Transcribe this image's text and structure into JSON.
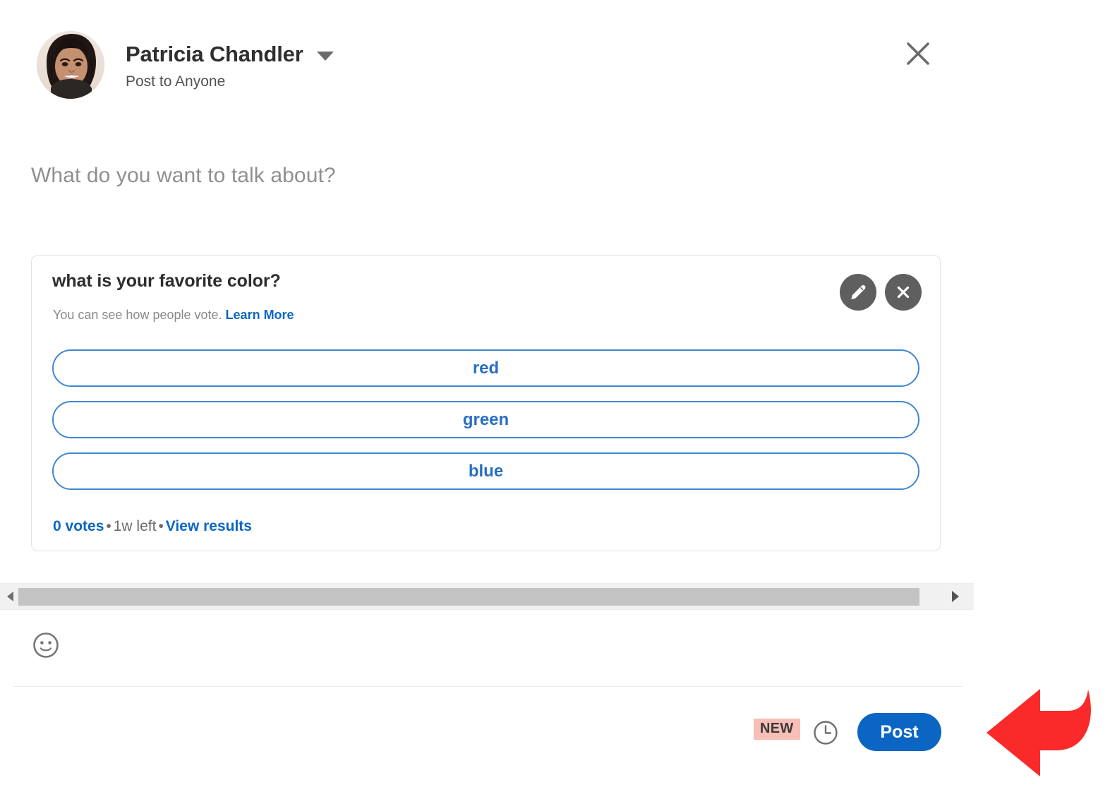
{
  "header": {
    "user_name": "Patricia Chandler",
    "visibility": "Post to Anyone",
    "caret_icon": "chevron-down-icon",
    "close_icon": "close-icon",
    "avatar_icon": "user-avatar-photo"
  },
  "editor": {
    "placeholder": "What do you want to talk about?",
    "value": ""
  },
  "poll": {
    "question": "what is your favorite color?",
    "subtext_prefix": "You can see how people vote.",
    "learn_more": "Learn More",
    "edit_icon": "pencil-icon",
    "remove_icon": "close-circle-icon",
    "options": [
      {
        "label": "red"
      },
      {
        "label": "green"
      },
      {
        "label": "blue"
      }
    ],
    "footer": {
      "votes": "0 votes",
      "separator": "•",
      "time_left": "1w left",
      "view_results": "View results"
    }
  },
  "scrollbar": {
    "left_arrow_icon": "triangle-left-icon",
    "right_arrow_icon": "triangle-right-icon",
    "orientation": "horizontal"
  },
  "toolbar": {
    "emoji_icon": "emoji-smiley-icon"
  },
  "footer_bar": {
    "new_badge": "NEW",
    "clock_icon": "clock-icon",
    "post_label": "Post"
  },
  "annotation": {
    "arrow_icon": "curved-arrow-left-icon",
    "color": "#fa2a2a"
  },
  "colors": {
    "accent_blue": "#0a66c2",
    "option_blue": "#2a6fc0",
    "option_border": "#3f86d2",
    "badge_pink": "#f7bfb7",
    "card_border": "#e2e2e2",
    "muted_text": "#8a8a8a",
    "scroll_thumb": "#c3c3c3"
  }
}
